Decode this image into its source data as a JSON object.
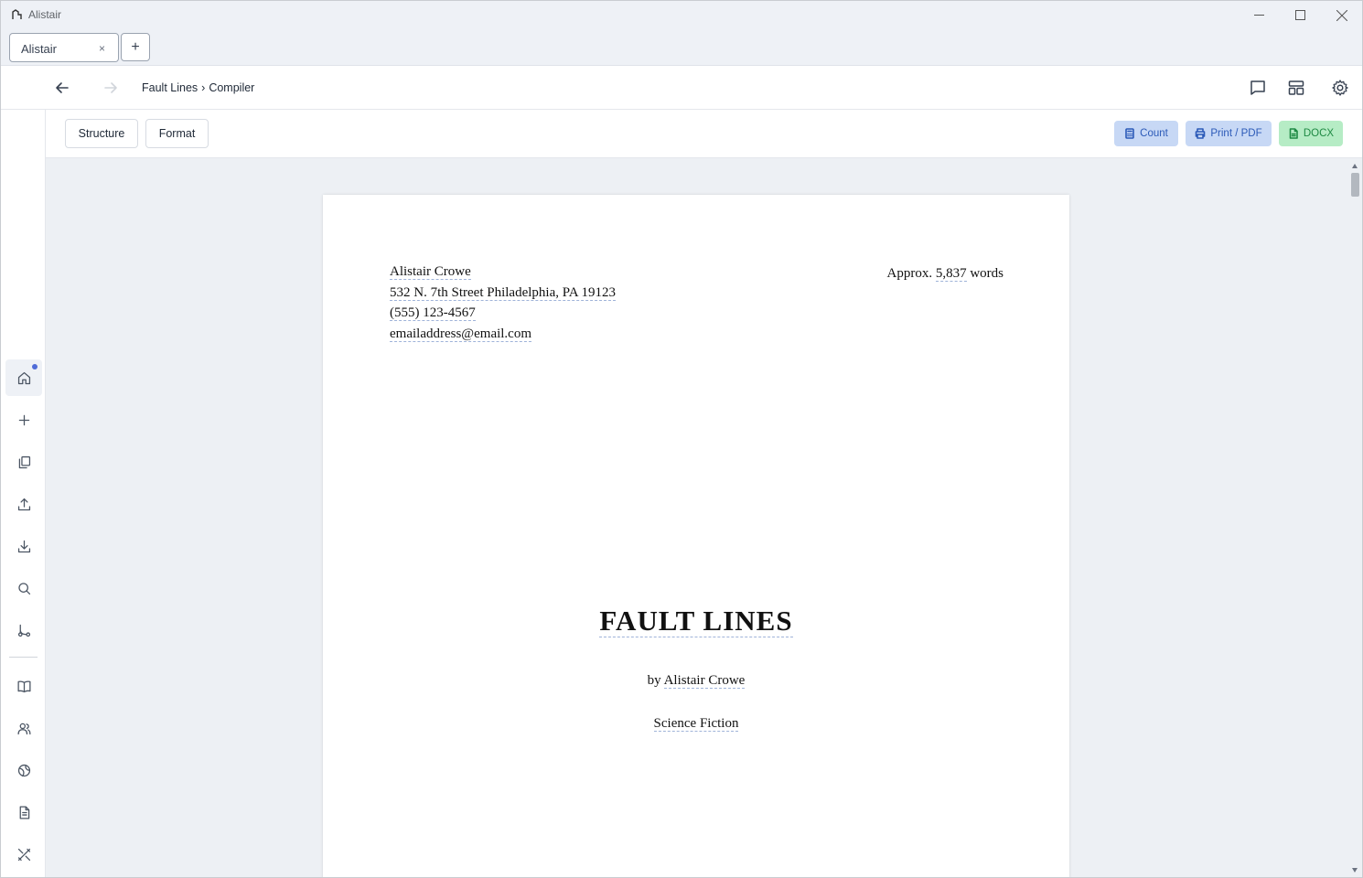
{
  "window": {
    "title": "Alistair",
    "icon": "app-logo-icon"
  },
  "tabs": [
    {
      "label": "Alistair",
      "close": "×"
    }
  ],
  "new_tab_label": "+",
  "nav": {
    "breadcrumb": [
      "Fault Lines",
      "›",
      "Compiler"
    ]
  },
  "toolbar": {
    "structure_label": "Structure",
    "format_label": "Format",
    "count_label": "Count",
    "print_label": "Print / PDF",
    "docx_label": "DOCX",
    "colors": {
      "count_bg": "#c7d8f5",
      "count_fg": "#2b5ab8",
      "print_bg": "#c7d8f5",
      "print_fg": "#2b5ab8",
      "docx_bg": "#b6ecc5",
      "docx_fg": "#1f8a44"
    }
  },
  "sidebar": {
    "items": [
      {
        "icon": "home-icon",
        "active": true
      },
      {
        "icon": "plus-icon"
      },
      {
        "icon": "copy-icon"
      },
      {
        "icon": "upload-icon"
      },
      {
        "icon": "download-icon"
      },
      {
        "icon": "search-icon"
      },
      {
        "icon": "git-branch-icon"
      },
      {
        "icon": "book-icon"
      },
      {
        "icon": "users-icon"
      },
      {
        "icon": "globe-icon"
      },
      {
        "icon": "document-icon"
      },
      {
        "icon": "tools-icon"
      }
    ]
  },
  "manuscript": {
    "author_name": "Alistair Crowe",
    "address": "532 N. 7th Street Philadelphia, PA 19123",
    "phone": "(555) 123-4567",
    "email": "emailaddress@email.com",
    "approx_prefix": "Approx.",
    "word_count": "5,837",
    "word_suffix": "words",
    "title": "FAULT LINES",
    "by_prefix": "by",
    "byline_author": "Alistair Crowe",
    "genre": "Science Fiction"
  }
}
